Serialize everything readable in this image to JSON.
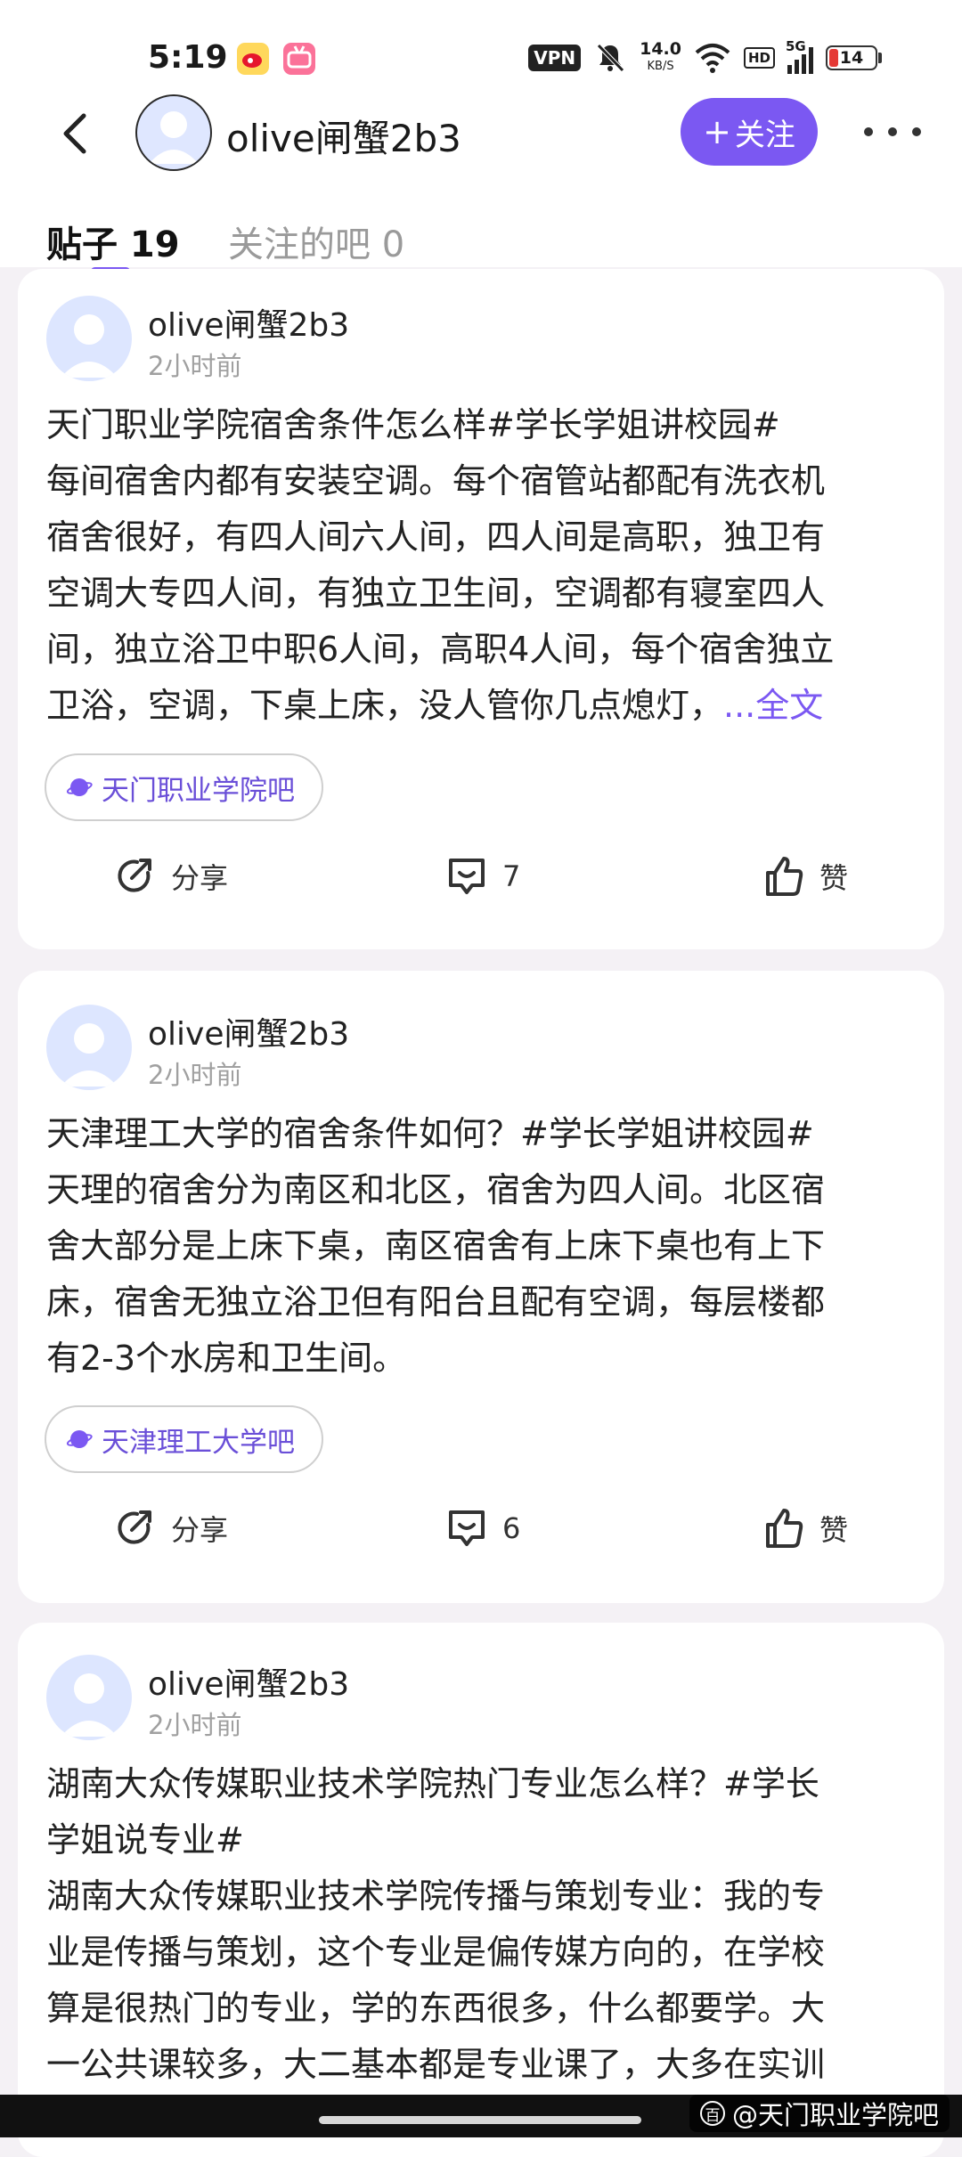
{
  "status_bar": {
    "time": "5:19",
    "vpn": "VPN",
    "speed_value": "14.0",
    "speed_unit": "KB/S",
    "hd": "HD",
    "network": "5G",
    "battery": "14"
  },
  "header": {
    "username": "olive闸蟹2b3",
    "follow_label": "关注",
    "follow_plus": "+"
  },
  "tabs": {
    "posts": "贴子 19",
    "followed_bars": "关注的吧 0"
  },
  "accent_color": "#7b58f2",
  "posts": [
    {
      "author": "olive闸蟹2b3",
      "time": "2小时前",
      "lines": [
        "天门职业学院宿舍条件怎么样#学长学姐讲校园#",
        "每间宿舍内都有安装空调。每个宿管站都配有洗衣机",
        "宿舍很好，有四人间六人间，四人间是高职，独卫有",
        "空调大专四人间，有独立卫生间，空调都有寝室四人",
        "间，独立浴卫中职6人间，高职4人间，每个宿舍独立",
        "卫浴，空调，下桌上床，没人管你几点熄灯，"
      ],
      "ellipsis": "...",
      "full_text_link": "全文",
      "bar": "天门职业学院吧",
      "share": "分享",
      "comments": "7",
      "like": "赞"
    },
    {
      "author": "olive闸蟹2b3",
      "time": "2小时前",
      "lines": [
        "天津理工大学的宿舍条件如何？#学长学姐讲校园#",
        "天理的宿舍分为南区和北区，宿舍为四人间。北区宿",
        "舍大部分是上床下桌，南区宿舍有上床下桌也有上下",
        "床，宿舍无独立浴卫但有阳台且配有空调，每层楼都",
        "有2-3个水房和卫生间。"
      ],
      "bar": "天津理工大学吧",
      "share": "分享",
      "comments": "6",
      "like": "赞"
    },
    {
      "author": "olive闸蟹2b3",
      "time": "2小时前",
      "lines": [
        "湖南大众传媒职业技术学院热门专业怎么样？#学长",
        "学姐说专业#",
        "湖南大众传媒职业技术学院传播与策划专业：我的专",
        "业是传播与策划，这个专业是偏传媒方向的，在学校",
        "算是很热门的专业，学的东西很多，什么都要学。大",
        "一公共课较多，大二基本都是专业课了，大多在实训"
      ]
    }
  ],
  "watermark": "@天门职业学院吧",
  "watermark_icon": "百"
}
